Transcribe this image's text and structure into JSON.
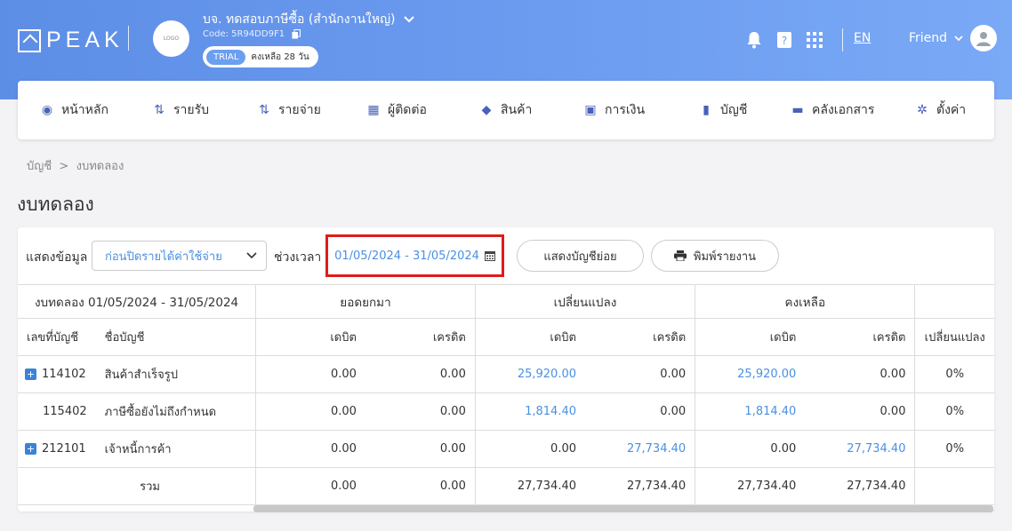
{
  "header": {
    "logo_text": "PEAK",
    "company_name": "บจ. ทดสอบภาษีซื้อ (สำนักงานใหญ่)",
    "company_code": "Code: 5R94DD9F1",
    "avatar_text": "LOGO",
    "trial_tag": "TRIAL",
    "trial_remaining": "คงเหลือ 28 วัน",
    "lang": "EN",
    "user_name": "Friend",
    "icons": [
      "bell-icon",
      "help-icon",
      "apps-grid-icon"
    ]
  },
  "nav": {
    "items": [
      {
        "label": "หน้าหลัก",
        "icon": "dashboard-icon"
      },
      {
        "label": "รายรับ",
        "icon": "income-icon"
      },
      {
        "label": "รายจ่าย",
        "icon": "expense-icon"
      },
      {
        "label": "ผู้ติดต่อ",
        "icon": "contacts-icon"
      },
      {
        "label": "สินค้า",
        "icon": "product-box-icon"
      },
      {
        "label": "การเงิน",
        "icon": "money-icon"
      },
      {
        "label": "บัญชี",
        "icon": "ledger-book-icon"
      },
      {
        "label": "คลังเอกสาร",
        "icon": "folder-icon"
      },
      {
        "label": "ตั้งค่า",
        "icon": "gear-icon"
      }
    ]
  },
  "breadcrumb": {
    "parent": "บัญชี",
    "separator": ">",
    "current": "งบทดลอง"
  },
  "page_title": "งบทดลอง",
  "filters": {
    "show_label": "แสดงข้อมูล",
    "show_value": "ก่อนปิดรายได้ค่าใช้จ่าย",
    "period_label": "ช่วงเวลา",
    "period_value": "01/05/2024 - 31/05/2024",
    "show_sub_button": "แสดงบัญชีย่อย",
    "print_button": "พิมพ์รายงาน"
  },
  "table": {
    "report_title": "งบทดลอง 01/05/2024 - 31/05/2024",
    "group_headers": [
      "ยอดยกมา",
      "เปลี่ยนแปลง",
      "คงเหลือ"
    ],
    "columns": {
      "account_no": "เลขที่บัญชี",
      "account_name": "ชื่อบัญชี",
      "debit": "เดบิต",
      "credit": "เครดิต",
      "change_pct": "เปลี่ยนแปลง"
    },
    "rows": [
      {
        "expandable": true,
        "no": "114102",
        "name": "สินค้าสำเร็จรูป",
        "open_dr": "0.00",
        "open_cr": "0.00",
        "chg_dr": "25,920.00",
        "chg_cr": "0.00",
        "bal_dr": "25,920.00",
        "bal_cr": "0.00",
        "pct": "0%"
      },
      {
        "expandable": false,
        "no": "115402",
        "name": "ภาษีซื้อยังไม่ถึงกำหนด",
        "open_dr": "0.00",
        "open_cr": "0.00",
        "chg_dr": "1,814.40",
        "chg_cr": "0.00",
        "bal_dr": "1,814.40",
        "bal_cr": "0.00",
        "pct": "0%"
      },
      {
        "expandable": true,
        "no": "212101",
        "name": "เจ้าหนี้การค้า",
        "open_dr": "0.00",
        "open_cr": "0.00",
        "chg_dr": "0.00",
        "chg_cr": "27,734.40",
        "bal_dr": "0.00",
        "bal_cr": "27,734.40",
        "pct": "0%"
      }
    ],
    "total": {
      "label": "รวม",
      "open_dr": "0.00",
      "open_cr": "0.00",
      "chg_dr": "27,734.40",
      "chg_cr": "27,734.40",
      "bal_dr": "27,734.40",
      "bal_cr": "27,734.40"
    }
  }
}
